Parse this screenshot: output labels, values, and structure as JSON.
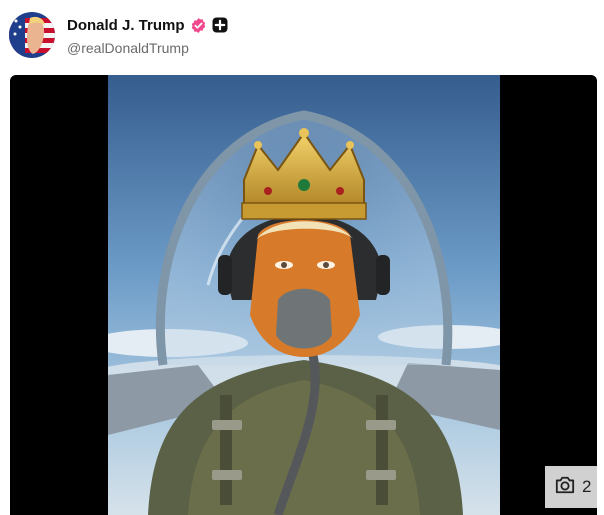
{
  "post": {
    "author": {
      "display_name": "Donald J. Trump",
      "handle": "@realDonaldTrump",
      "verified": true,
      "badge_icon": "plus-badge-icon"
    },
    "media": {
      "type": "image",
      "count_icon": "camera-icon",
      "count": "2"
    }
  },
  "colors": {
    "verified": "#f0498d",
    "handle": "#6b6b6b",
    "media_background": "#000000"
  }
}
